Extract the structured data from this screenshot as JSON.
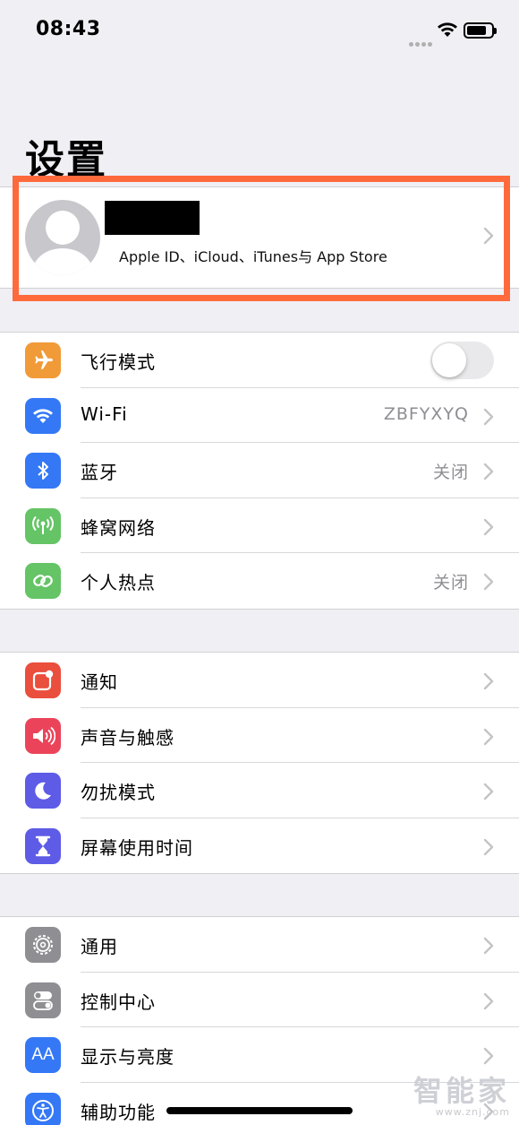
{
  "status_bar": {
    "time": "08:43"
  },
  "page": {
    "title": "设置"
  },
  "profile": {
    "subtitle": "Apple ID、iCloud、iTunes与 App Store"
  },
  "group1": [
    {
      "icon": "airplane-icon",
      "label": "飞行模式",
      "value": "",
      "color": "#f19a38",
      "toggle_on": false
    },
    {
      "icon": "wifi-icon",
      "label": "Wi-Fi",
      "value": "ZBFYXYQ",
      "color": "#3478f6"
    },
    {
      "icon": "bluetooth-icon",
      "label": "蓝牙",
      "value": "关闭",
      "color": "#3478f6"
    },
    {
      "icon": "cellular-icon",
      "label": "蜂窝网络",
      "value": "",
      "color": "#65c466"
    },
    {
      "icon": "hotspot-icon",
      "label": "个人热点",
      "value": "关闭",
      "color": "#65c466"
    }
  ],
  "group2": [
    {
      "icon": "notifications-icon",
      "label": "通知",
      "color": "#ea4e3d"
    },
    {
      "icon": "sounds-icon",
      "label": "声音与触感",
      "color": "#eb445a"
    },
    {
      "icon": "do-not-disturb-icon",
      "label": "勿扰模式",
      "color": "#5e5ce6"
    },
    {
      "icon": "screen-time-icon",
      "label": "屏幕使用时间",
      "color": "#5e5ce6"
    }
  ],
  "group3": [
    {
      "icon": "gear-icon",
      "label": "通用",
      "color": "#8e8e93"
    },
    {
      "icon": "control-center-icon",
      "label": "控制中心",
      "color": "#8e8e93"
    },
    {
      "icon": "display-icon",
      "label": "显示与亮度",
      "color": "#3478f6",
      "icon_text": "AA"
    },
    {
      "icon": "accessibility-icon",
      "label": "辅助功能",
      "color": "#3478f6"
    }
  ],
  "watermark": {
    "main": "智能家",
    "url": "www.znj.com"
  }
}
